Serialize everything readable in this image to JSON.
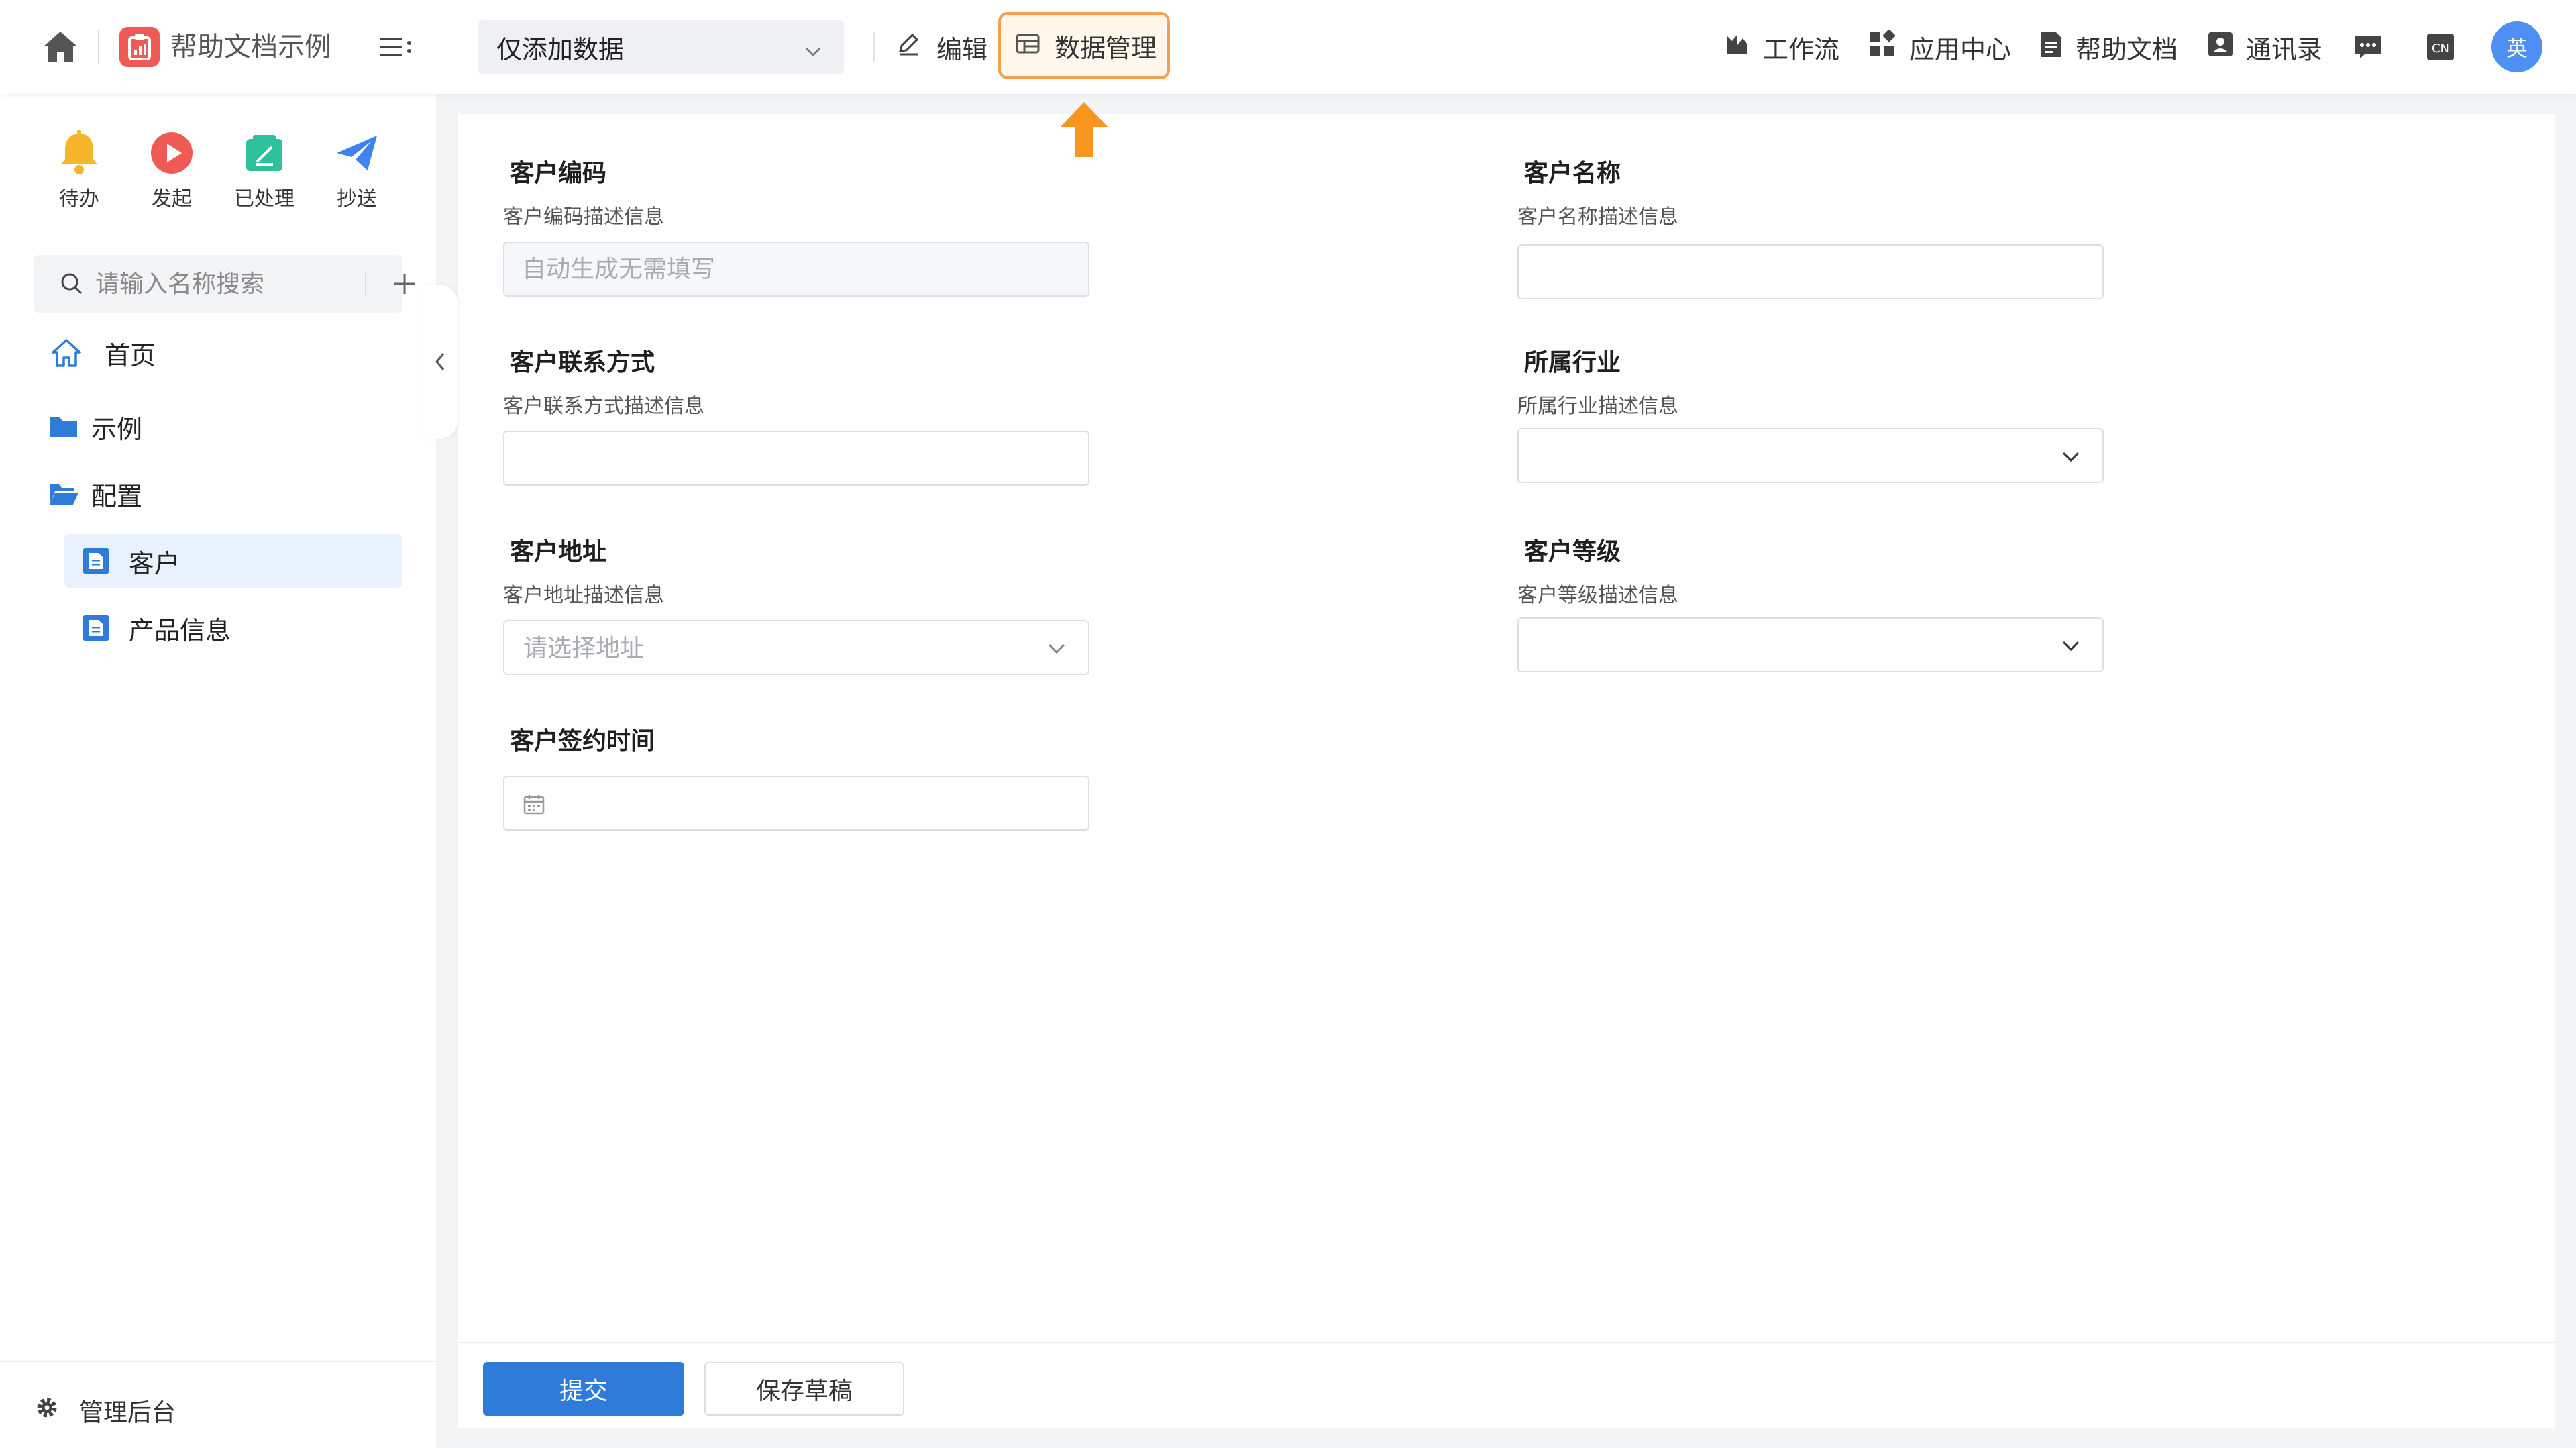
{
  "header": {
    "app_title": "帮助文档示例",
    "view_mode": "仅添加数据",
    "edit_label": "编辑",
    "data_manage_label": "数据管理",
    "right_links": [
      {
        "label": "工作流",
        "icon": "workflow-icon"
      },
      {
        "label": "应用中心",
        "icon": "app-center-icon"
      },
      {
        "label": "帮助文档",
        "icon": "document-icon"
      },
      {
        "label": "通讯录",
        "icon": "contacts-icon"
      }
    ],
    "lang_badge": "CN",
    "avatar_text": "英",
    "accent_color": "#f6a04d"
  },
  "sidebar": {
    "quick_actions": [
      {
        "label": "待办",
        "icon": "bell-icon",
        "color": "#f7b52c"
      },
      {
        "label": "发起",
        "icon": "play-icon",
        "color": "#f05a55"
      },
      {
        "label": "已处理",
        "icon": "check-doc-icon",
        "color": "#2cc19a"
      },
      {
        "label": "抄送",
        "icon": "send-icon",
        "color": "#3f83f2"
      }
    ],
    "search_placeholder": "请输入名称搜索",
    "nav": [
      {
        "label": "首页",
        "icon": "home-icon"
      },
      {
        "label": "示例",
        "icon": "folder-icon"
      },
      {
        "label": "配置",
        "icon": "folder-open-icon"
      },
      {
        "label": "客户",
        "icon": "page-icon",
        "active": true
      },
      {
        "label": "产品信息",
        "icon": "page-icon"
      }
    ],
    "admin_label": "管理后台"
  },
  "form": {
    "customer_code": {
      "label": "客户编码",
      "desc": "客户编码描述信息",
      "placeholder": "自动生成无需填写",
      "value": ""
    },
    "customer_name": {
      "label": "客户名称",
      "desc": "客户名称描述信息",
      "placeholder": "",
      "value": ""
    },
    "customer_contact": {
      "label": "客户联系方式",
      "desc": "客户联系方式描述信息",
      "placeholder": "",
      "value": ""
    },
    "industry": {
      "label": "所属行业",
      "desc": "所属行业描述信息",
      "selected": ""
    },
    "customer_address": {
      "label": "客户地址",
      "desc": "客户地址描述信息",
      "placeholder": "请选择地址"
    },
    "customer_level": {
      "label": "客户等级",
      "desc": "客户等级描述信息",
      "selected": ""
    },
    "sign_time": {
      "label": "客户签约时间",
      "value": ""
    }
  },
  "footer": {
    "submit_label": "提交",
    "draft_label": "保存草稿",
    "primary_color": "#2f7bd9"
  }
}
